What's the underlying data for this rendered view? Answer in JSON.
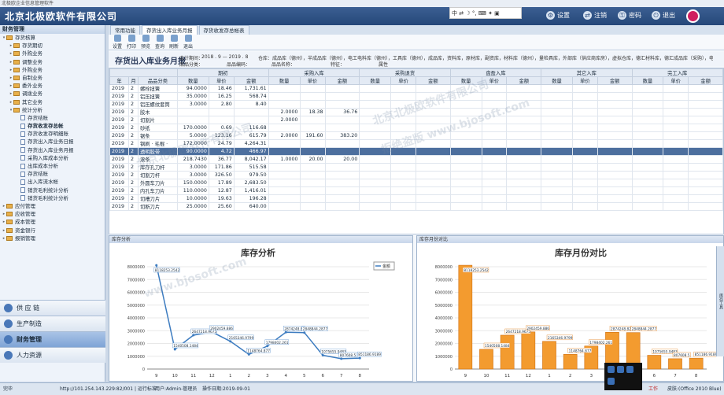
{
  "window": {
    "title": "北极欧企业信息管理软件"
  },
  "header": {
    "app_title": "北京北极欧软件有限公司",
    "buttons": [
      {
        "label": "设置"
      },
      {
        "label": "注销"
      },
      {
        "label": "密码"
      },
      {
        "label": "退出"
      }
    ],
    "ime": "中 ⇄ ☽ °, ⌨ ✦ ▣"
  },
  "sidebar": {
    "title": "财务管理",
    "tree": [
      {
        "label": "存货核算",
        "level": 0,
        "type": "folder",
        "open": true
      },
      {
        "label": "存货期初",
        "level": 1,
        "type": "folder"
      },
      {
        "label": "外购业务",
        "level": 1,
        "type": "folder"
      },
      {
        "label": "调整业务",
        "level": 1,
        "type": "folder"
      },
      {
        "label": "外购业务",
        "level": 1,
        "type": "folder"
      },
      {
        "label": "自制业务",
        "level": 1,
        "type": "folder"
      },
      {
        "label": "委外业务",
        "level": 1,
        "type": "folder"
      },
      {
        "label": "调拨业务",
        "level": 1,
        "type": "folder"
      },
      {
        "label": "其它业务",
        "level": 1,
        "type": "folder"
      },
      {
        "label": "统计分析",
        "level": 1,
        "type": "folder",
        "open": true
      },
      {
        "label": "存货结账",
        "level": 2,
        "type": "doc"
      },
      {
        "label": "存货收发存总帐",
        "level": 2,
        "type": "doc",
        "selected": true
      },
      {
        "label": "存货收发存明细账",
        "level": 2,
        "type": "doc"
      },
      {
        "label": "存货出入库业务日报",
        "level": 2,
        "type": "doc"
      },
      {
        "label": "存货出入库业务月报",
        "level": 2,
        "type": "doc"
      },
      {
        "label": "采购入库成本分析",
        "level": 2,
        "type": "doc"
      },
      {
        "label": "出库成本分析",
        "level": 2,
        "type": "doc"
      },
      {
        "label": "存货结账",
        "level": 2,
        "type": "doc"
      },
      {
        "label": "出入库流水帐",
        "level": 2,
        "type": "doc"
      },
      {
        "label": "销货毛利统计分析",
        "level": 2,
        "type": "doc"
      },
      {
        "label": "销货毛利统计分析",
        "level": 2,
        "type": "doc"
      },
      {
        "label": "应付管理",
        "level": 0,
        "type": "folder"
      },
      {
        "label": "应收管理",
        "level": 0,
        "type": "folder"
      },
      {
        "label": "成本管理",
        "level": 0,
        "type": "folder"
      },
      {
        "label": "资金银行",
        "level": 0,
        "type": "folder"
      },
      {
        "label": "报销管理",
        "level": 0,
        "type": "folder"
      }
    ],
    "modules": [
      {
        "label": "供 应 链",
        "active": false
      },
      {
        "label": "生产制造",
        "active": false
      },
      {
        "label": "财务管理",
        "active": true
      },
      {
        "label": "人力资源",
        "active": false
      }
    ]
  },
  "tabs": [
    {
      "label": "常用功能",
      "active": false
    },
    {
      "label": "存货出入库业务月报",
      "active": true
    },
    {
      "label": "存货收发存总帐表",
      "active": false
    }
  ],
  "toolbar": [
    {
      "label": "设置"
    },
    {
      "label": "打印"
    },
    {
      "label": "预览"
    },
    {
      "label": "查询"
    },
    {
      "label": "刷新"
    },
    {
      "label": "退出"
    }
  ],
  "report": {
    "title": "存货出入库业务月报",
    "period_label": "会计期间：",
    "period_value": "2018 . 9 — 2019 . 8",
    "warehouse_label": "仓库：",
    "warehouse_value": "成品库（德州），半成品库（德州），电工电料库（德州），工具库（德州），成品库，资料库，原材库，副资库，材料库（德州），量检具库，外部库（供应商库房），虚拟仓库，德汇材料库，德汇成品库（采购），电工电料库（采购），电",
    "cat_label": "品品分类：",
    "code_label": "品品编码：",
    "name_label": "品品名称：",
    "feature_label": "特征：",
    "attr_label": "属性"
  },
  "table": {
    "header_top": {
      "begin": "期初",
      "inbound": "入库",
      "purchase_in": "采购入库",
      "purchase_return": "采购退货",
      "misc_in": "盘盈入库",
      "other_in": "其它入库",
      "finish_in": "完工入库"
    },
    "header_cols": {
      "year": "年",
      "month": "月",
      "category": "品品分类",
      "qty": "数量",
      "price": "单价",
      "amount": "金额"
    },
    "rows": [
      {
        "year": "2019",
        "month": "2",
        "cat": "螺栓扭簧",
        "qty": "94.0000",
        "price": "18.46",
        "amount": "1,731.61",
        "pq": "",
        "pp": "",
        "pa": ""
      },
      {
        "year": "2019",
        "month": "2",
        "cat": "铝压扭簧",
        "qty": "35.0000",
        "price": "16.25",
        "amount": "568.74",
        "pq": "",
        "pp": "",
        "pa": ""
      },
      {
        "year": "2019",
        "month": "2",
        "cat": "铝压螺纹套筒",
        "qty": "3.0000",
        "price": "2.80",
        "amount": "8.40",
        "pq": "",
        "pp": "",
        "pa": ""
      },
      {
        "year": "2019",
        "month": "2",
        "cat": "胶木",
        "qty": "",
        "price": "",
        "amount": "",
        "pq": "2.0000",
        "pp": "18.38",
        "pa": "36.76"
      },
      {
        "year": "2019",
        "month": "2",
        "cat": "切割片",
        "qty": "",
        "price": "",
        "amount": "",
        "pq": "2.0000",
        "pp": "",
        "pa": ""
      },
      {
        "year": "2019",
        "month": "2",
        "cat": "砂纸",
        "qty": "170.0000",
        "price": "0.69",
        "amount": "116.68",
        "pq": "",
        "pp": "",
        "pa": ""
      },
      {
        "year": "2019",
        "month": "2",
        "cat": "锯条",
        "qty": "5.0000",
        "price": "123.16",
        "amount": "615.79",
        "pq": "2.0000",
        "pp": "191.60",
        "pa": "383.20"
      },
      {
        "year": "2019",
        "month": "2",
        "cat": "钢刷 · 毛棍 ·",
        "qty": "172.0000",
        "price": "24.79",
        "amount": "4,264.31",
        "pq": "",
        "pp": "",
        "pa": ""
      },
      {
        "year": "2019",
        "month": "2",
        "cat": "透明胶带",
        "qty": "90.0000",
        "price": "4.72",
        "amount": "466.97",
        "pq": "",
        "pp": "",
        "pa": "",
        "selected": true
      },
      {
        "year": "2019",
        "month": "2",
        "cat": "滚条",
        "qty": "218.7430",
        "price": "36.77",
        "amount": "8,042.17",
        "pq": "1.0000",
        "pp": "20.00",
        "pa": "20.00"
      },
      {
        "year": "2019",
        "month": "2",
        "cat": "库存孔刀杆",
        "qty": "3.0000",
        "price": "171.86",
        "amount": "515.58",
        "pq": "",
        "pp": "",
        "pa": ""
      },
      {
        "year": "2019",
        "month": "2",
        "cat": "切割刀杆",
        "qty": "3.0000",
        "price": "326.50",
        "amount": "979.50",
        "pq": "",
        "pp": "",
        "pa": ""
      },
      {
        "year": "2019",
        "month": "2",
        "cat": "外圆车刀片",
        "qty": "150.0000",
        "price": "17.89",
        "amount": "2,683.50",
        "pq": "",
        "pp": "",
        "pa": ""
      },
      {
        "year": "2019",
        "month": "2",
        "cat": "内孔车刀片",
        "qty": "110.0000",
        "price": "12.87",
        "amount": "1,416.01",
        "pq": "",
        "pp": "",
        "pa": ""
      },
      {
        "year": "2019",
        "month": "2",
        "cat": "切槽刀片",
        "qty": "10.0000",
        "price": "19.63",
        "amount": "196.28",
        "pq": "",
        "pp": "",
        "pa": ""
      },
      {
        "year": "2019",
        "month": "2",
        "cat": "切断刀片",
        "qty": "25.0000",
        "price": "25.60",
        "amount": "640.00",
        "pq": "",
        "pp": "",
        "pa": ""
      }
    ]
  },
  "panels": {
    "left_title": "库存分析",
    "right_title": "库存月份对比",
    "right_side_label": "库存工具"
  },
  "chart_data": [
    {
      "type": "line",
      "title": "库存分析",
      "legend": [
        "金额"
      ],
      "legend_placement": "top-right",
      "categories": [
        "9",
        "10",
        "11",
        "12",
        "1",
        "2",
        "3",
        "4",
        "5",
        "6",
        "7",
        "8"
      ],
      "series": [
        {
          "name": "金额",
          "values": [
            8118253.2542,
            1540508.1484,
            2647218.9675,
            2902459.886,
            2165346.9799,
            1148764.877,
            1798402.261,
            2874248.82,
            2848844.2877,
            1075655.9483,
            807608.5,
            851186.9189
          ]
        }
      ],
      "value_labels": [
        "8118253.2542",
        "1540508.1484",
        "2647218.9675",
        "2902459.886",
        "2165346.9799",
        "1148764.877",
        "1798402.261",
        "2874248.82",
        "2848844.2877",
        "1075655.9483",
        "807608.5",
        "851186.9189"
      ],
      "ylim": [
        0,
        8000000
      ],
      "yticks": [
        "0",
        "1000000",
        "2000000",
        "3000000",
        "4000000",
        "5000000",
        "6000000",
        "7000000",
        "8000000"
      ]
    },
    {
      "type": "bar",
      "title": "库存月份对比",
      "categories": [
        "9",
        "10",
        "11",
        "12",
        "1",
        "2",
        "3",
        "4",
        "5",
        "6",
        "7",
        "8"
      ],
      "values": [
        8118253.2542,
        1540508.1484,
        2647218.9675,
        2902459.886,
        2165346.9799,
        1148764.877,
        1798402.261,
        2874248.82,
        2848844.2877,
        1075655.9483,
        807608.5,
        851186.9189
      ],
      "value_labels": [
        "8118253.2542",
        "1540508.1484",
        "2647218.9675",
        "2902459.886",
        "2165346.9799",
        "1148764.877",
        "1798402.261",
        "2874248.82",
        "2848844.2877",
        "1075655.9483",
        "807608.5",
        "851186.9189"
      ],
      "ylim": [
        0,
        8000000
      ],
      "yticks": [
        "0",
        "1000000",
        "2000000",
        "3000000",
        "4000000",
        "5000000",
        "6000000",
        "7000000",
        "8000000"
      ],
      "color": "#f39b2f"
    }
  ],
  "status": {
    "ready": "完毕",
    "url": "http://101.254.143.229:82/001 | 运行标准",
    "user": "用户:Admin-管理员",
    "date": "操作日期:2019-09-01",
    "skin": "皮肤:(Office 2010 Blue)",
    "work": "工作"
  },
  "watermarks": [
    "北京北极欧软件有限公司",
    "拒绝盗版 www.bjosoft.com",
    "北京北极欧软件有限公司",
    "www.bjosoft.com"
  ]
}
